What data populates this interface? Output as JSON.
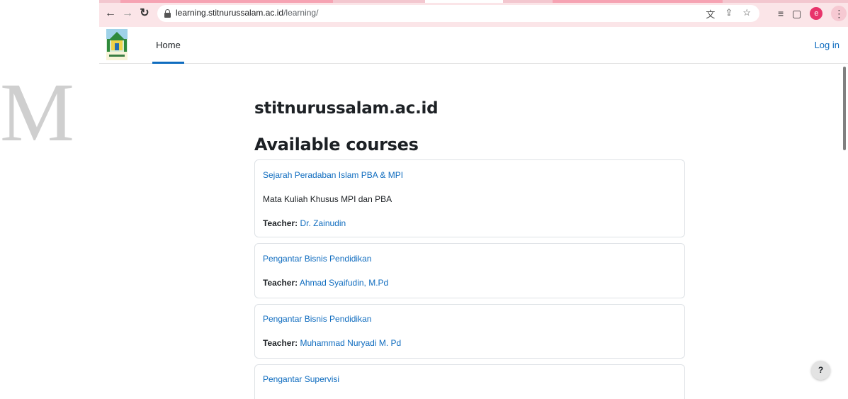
{
  "browser": {
    "url_host": "learning.stitnurussalam.ac.id",
    "url_path": "/learning/",
    "profile_initial": "e"
  },
  "navbar": {
    "home_label": "Home",
    "login_label": "Log in"
  },
  "page": {
    "site_title": "stitnurussalam.ac.id",
    "section_title": "Available courses"
  },
  "courses": [
    {
      "name": "Sejarah Peradaban Islam PBA & MPI",
      "summary": "Mata Kuliah Khusus MPI dan PBA",
      "teacher_label": "Teacher:",
      "teacher": "Dr. Zainudin"
    },
    {
      "name": "Pengantar Bisnis Pendidikan",
      "summary": "",
      "teacher_label": "Teacher:",
      "teacher": "Ahmad Syaifudin, M.Pd"
    },
    {
      "name": "Pengantar Bisnis Pendidikan",
      "summary": "",
      "teacher_label": "Teacher:",
      "teacher": "Muhammad Nuryadi M. Pd"
    },
    {
      "name": "Pengantar Supervisi",
      "summary": "",
      "teacher_label": "",
      "teacher": ""
    }
  ],
  "help": {
    "label": "?"
  },
  "watermark": {
    "text": "M"
  },
  "colors": {
    "link": "#0f6cbf",
    "chrome_bg": "#fbe5e8",
    "profile": "#e8346b"
  }
}
